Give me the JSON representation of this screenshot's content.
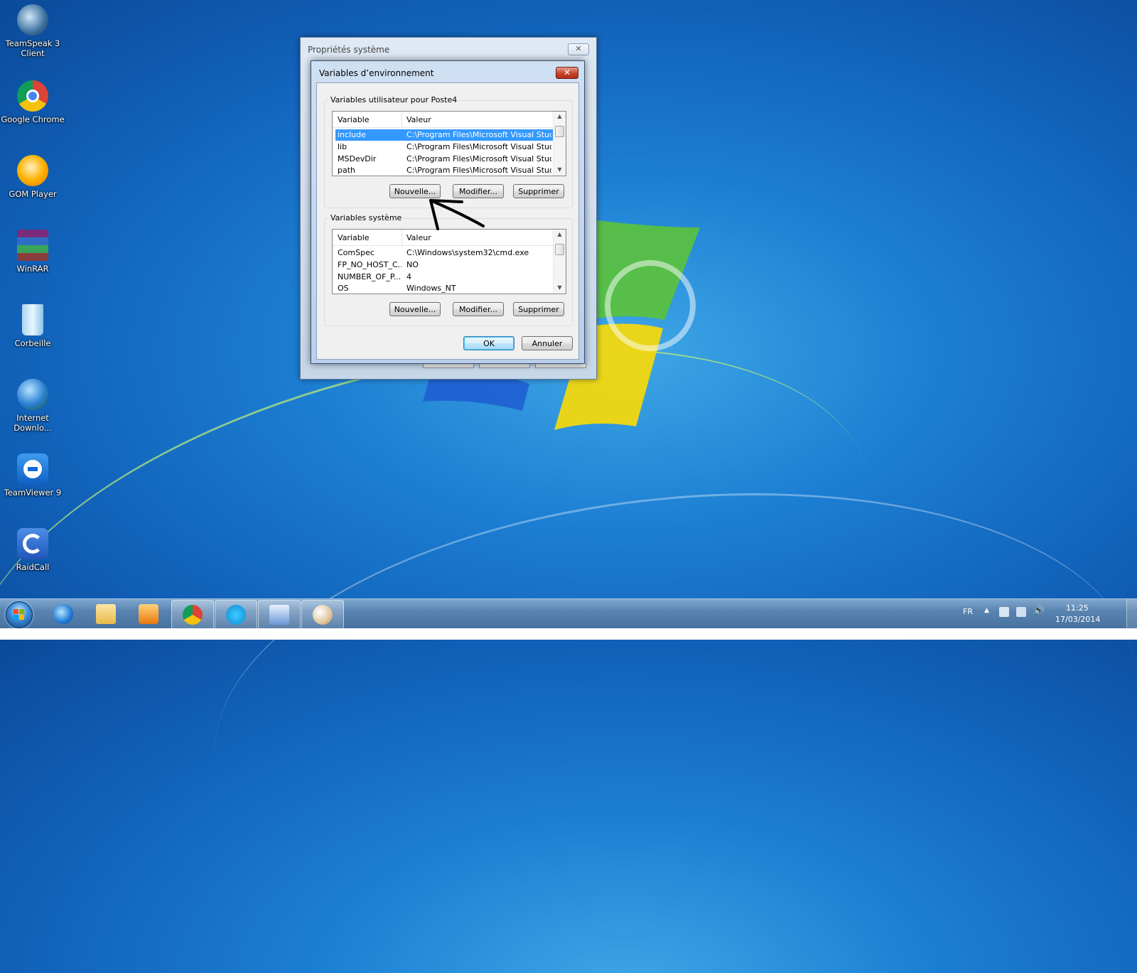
{
  "desktop": {
    "icons": [
      {
        "label": "TeamSpeak 3\nClient"
      },
      {
        "label": "Google Chrome"
      },
      {
        "label": "GOM Player"
      },
      {
        "label": "WinRAR"
      },
      {
        "label": "Corbeille"
      },
      {
        "label": "Internet\nDownlo..."
      },
      {
        "label": "TeamViewer 9"
      },
      {
        "label": "RaidCall"
      }
    ]
  },
  "system_properties": {
    "title": "Propriétés système",
    "close_glyph": "✕"
  },
  "env_dialog": {
    "title": "Variables d’environnement",
    "close_glyph": "✕",
    "user_group": {
      "legend": "Variables utilisateur pour Poste4",
      "columns": [
        "Variable",
        "Valeur"
      ],
      "rows": [
        {
          "name": "include",
          "value": "C:\\Program Files\\Microsoft Visual Studio...",
          "selected": true
        },
        {
          "name": "lib",
          "value": "C:\\Program Files\\Microsoft Visual Studio...",
          "selected": false
        },
        {
          "name": "MSDevDir",
          "value": "C:\\Program Files\\Microsoft Visual Studio...",
          "selected": false
        },
        {
          "name": "path",
          "value": "C:\\Program Files\\Microsoft Visual Studio...",
          "selected": false
        }
      ],
      "buttons": {
        "new": "Nouvelle...",
        "edit": "Modifier...",
        "delete": "Supprimer"
      }
    },
    "system_group": {
      "legend": "Variables système",
      "columns": [
        "Variable",
        "Valeur"
      ],
      "rows": [
        {
          "name": "ComSpec",
          "value": "C:\\Windows\\system32\\cmd.exe"
        },
        {
          "name": "FP_NO_HOST_C...",
          "value": "NO"
        },
        {
          "name": "NUMBER_OF_P...",
          "value": "4"
        },
        {
          "name": "OS",
          "value": "Windows_NT"
        }
      ],
      "buttons": {
        "new": "Nouvelle...",
        "edit": "Modifier...",
        "delete": "Supprimer"
      }
    },
    "ok": "OK",
    "cancel": "Annuler"
  },
  "taskbar": {
    "pinned": [
      "internet-explorer-icon",
      "windows-explorer-icon",
      "media-player-icon",
      "chrome-icon",
      "skype-icon",
      "remote-desktop-icon",
      "paint-icon"
    ],
    "active_index": [
      3,
      4,
      5,
      6
    ],
    "language": "FR",
    "time": "11:25",
    "date": "17/03/2014",
    "colors": {
      "bar": "#46709e",
      "accent": "#3399ff"
    }
  }
}
